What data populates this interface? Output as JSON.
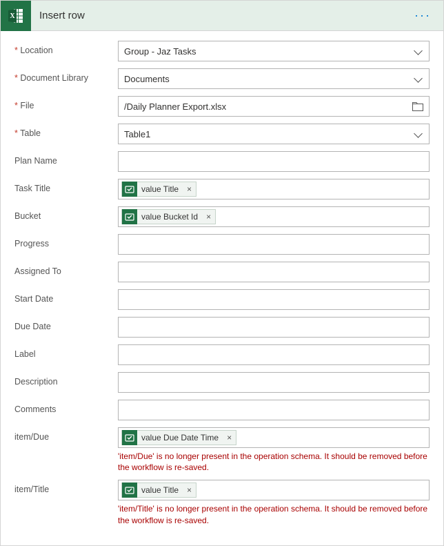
{
  "header": {
    "title": "Insert row",
    "icon": "excel-icon",
    "menu_icon": "more-icon"
  },
  "fields": {
    "location": {
      "label": "Location",
      "required": true,
      "value": "Group - Jaz Tasks",
      "kind": "dropdown"
    },
    "docLibrary": {
      "label": "Document Library",
      "required": true,
      "value": "Documents",
      "kind": "dropdown"
    },
    "file": {
      "label": "File",
      "required": true,
      "value": "/Daily Planner Export.xlsx",
      "kind": "file"
    },
    "table": {
      "label": "Table",
      "required": true,
      "value": "Table1",
      "kind": "dropdown"
    },
    "planName": {
      "label": "Plan Name",
      "required": false
    },
    "taskTitle": {
      "label": "Task Title",
      "required": false,
      "tokens": [
        {
          "label": "value Title"
        }
      ]
    },
    "bucket": {
      "label": "Bucket",
      "required": false,
      "tokens": [
        {
          "label": "value Bucket Id"
        }
      ]
    },
    "progress": {
      "label": "Progress",
      "required": false
    },
    "assignedTo": {
      "label": "Assigned To",
      "required": false
    },
    "startDate": {
      "label": "Start Date",
      "required": false
    },
    "dueDate": {
      "label": "Due Date",
      "required": false
    },
    "labelField": {
      "label": "Label",
      "required": false
    },
    "description": {
      "label": "Description",
      "required": false
    },
    "comments": {
      "label": "Comments",
      "required": false
    },
    "itemDue": {
      "label": "item/Due",
      "required": false,
      "tokens": [
        {
          "label": "value Due Date Time"
        }
      ],
      "error": "'item/Due' is no longer present in the operation schema. It should be removed before the workflow is re-saved."
    },
    "itemTitle": {
      "label": "item/Title",
      "required": false,
      "tokens": [
        {
          "label": "value Title"
        }
      ],
      "error": "'item/Title' is no longer present in the operation schema. It should be removed before the workflow is re-saved."
    }
  }
}
